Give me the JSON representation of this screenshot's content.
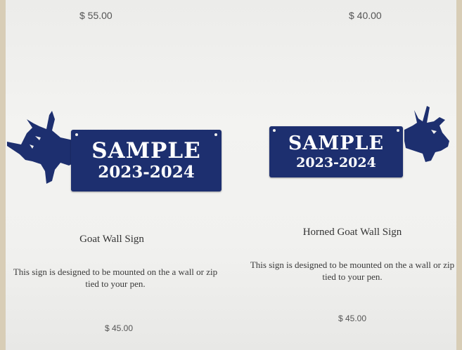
{
  "products": [
    {
      "top_price": "$ 55.00",
      "sign_line1": "SAMPLE",
      "sign_line2": "2023-2024",
      "title": "Goat Wall Sign",
      "description": "This sign is designed to be mounted on the a wall or zip tied to your pen.",
      "price": "$ 45.00"
    },
    {
      "top_price": "$ 40.00",
      "sign_line1": "SAMPLE",
      "sign_line2": "2023-2024",
      "title": "Horned Goat Wall Sign",
      "description": "This sign is designed to be mounted on the a wall or zip tied to your pen.",
      "price": "$ 45.00"
    }
  ],
  "colors": {
    "sign_blue": "#1d2f6f",
    "text": "#333333"
  },
  "icons": [
    "goat-silhouette-icon",
    "horned-goat-silhouette-icon"
  ]
}
